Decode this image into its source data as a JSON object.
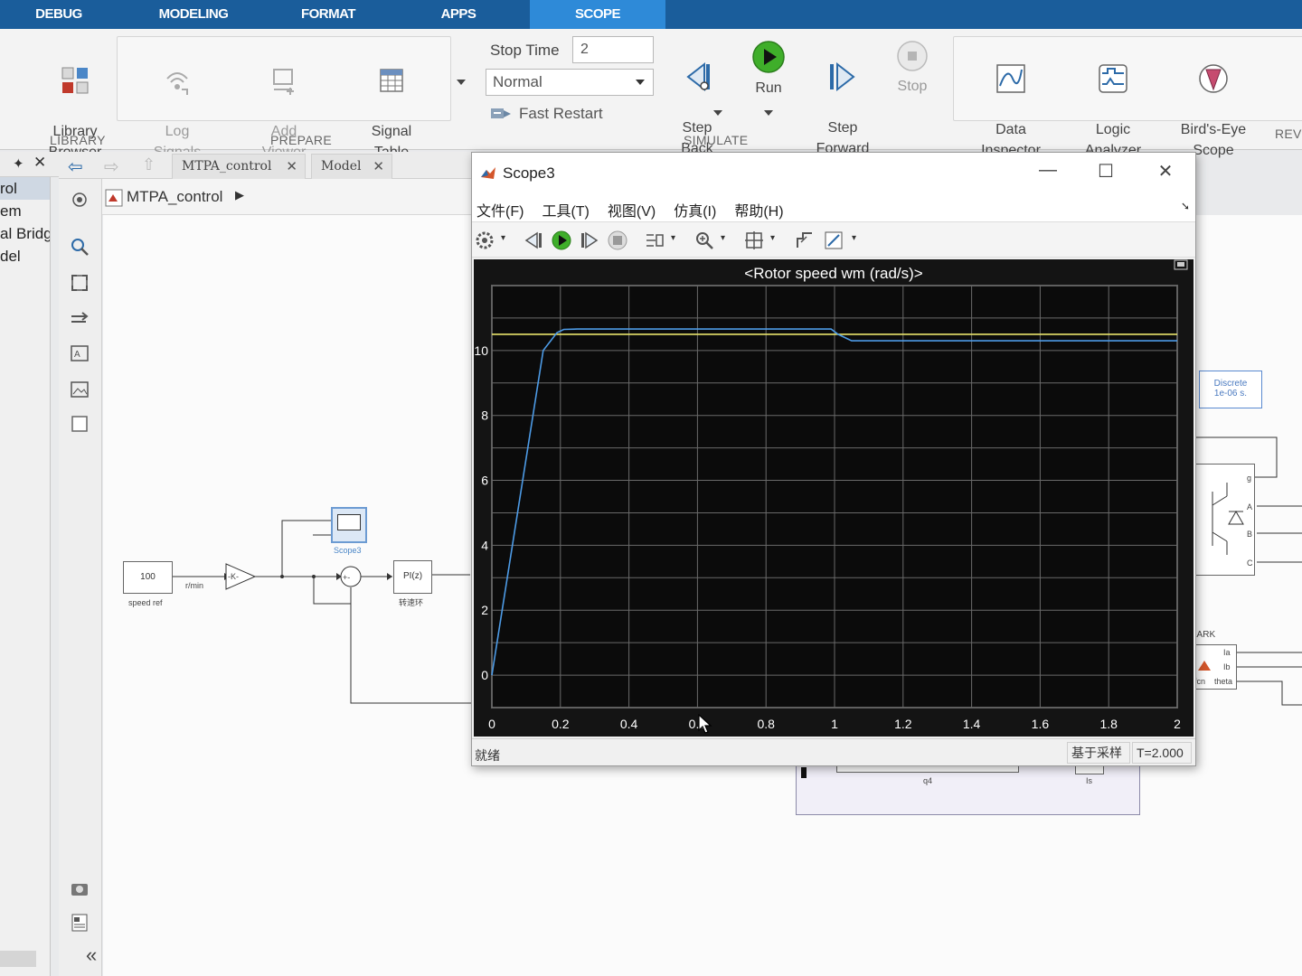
{
  "toolstrip_tabs": [
    {
      "label": "DEBUG",
      "active": false
    },
    {
      "label": "MODELING",
      "active": false
    },
    {
      "label": "FORMAT",
      "active": false
    },
    {
      "label": "APPS",
      "active": false
    },
    {
      "label": "SCOPE",
      "active": true
    }
  ],
  "ribbon": {
    "library": {
      "caption": "LIBRARY",
      "library_browser": "Library\nBrowser"
    },
    "prepare": {
      "caption": "PREPARE",
      "log_signals": "Log\nSignals",
      "add_viewer": "Add\nViewer",
      "signal_table": "Signal\nTable"
    },
    "simulate": {
      "caption": "SIMULATE",
      "stop_time_label": "Stop Time",
      "stop_time_value": "2",
      "mode_value": "Normal",
      "fast_restart": "Fast Restart",
      "step_back": "Step\nBack",
      "run": "Run",
      "step_forward": "Step\nForward",
      "stop": "Stop"
    },
    "review": {
      "caption": "REVI",
      "data_inspector": "Data\nInspector",
      "logic_analyzer": "Logic\nAnalyzer",
      "birds_eye": "Bird's-Eye\nScope"
    }
  },
  "left_panel": {
    "items": [
      "rol",
      "em",
      "al Bridg",
      "del"
    ]
  },
  "model_tabs": [
    {
      "label": "MTPA_control"
    },
    {
      "label": "Model"
    }
  ],
  "breadcrumb": {
    "model": "MTPA_control"
  },
  "diagram": {
    "const_value": "100",
    "const_label": "speed ref",
    "wire_label": "r/min",
    "gain_label": "-K-",
    "scope_label": "Scope3",
    "pi_label": "PI(z)",
    "pi_caption": "转速环",
    "discrete_line1": "Discrete",
    "discrete_line2": "1e-06 s.",
    "bridge_ports": [
      "g",
      "A",
      "B",
      "C"
    ],
    "park_label": "LARK",
    "park_ports": [
      "Ia",
      "Ib",
      "theta"
    ],
    "park_fcn": "fcn",
    "q4_label": "q4",
    "is_label": "Is"
  },
  "scope_window": {
    "title": "Scope3",
    "menu": [
      "文件(F)",
      "工具(T)",
      "视图(V)",
      "仿真(I)",
      "帮助(H)"
    ],
    "status_left": "就绪",
    "status_sample": "基于采样",
    "status_time": "T=2.000"
  },
  "chart_data": {
    "type": "line",
    "title": "<Rotor speed wm (rad/s)>",
    "xlabel": "",
    "ylabel": "",
    "xlim": [
      0,
      2
    ],
    "ylim": [
      -1,
      12
    ],
    "xticks": [
      0,
      0.2,
      0.4,
      0.6,
      0.8,
      1,
      1.2,
      1.4,
      1.6,
      1.8,
      2
    ],
    "xtick_labels": [
      "0",
      "0.2",
      "0.4",
      "0.6",
      "0.8",
      "1",
      "1.2",
      "1.4",
      "1.6",
      "1.8",
      "2"
    ],
    "yticks": [
      0,
      2,
      4,
      6,
      8,
      10
    ],
    "grid": true,
    "background": "#141414",
    "series": [
      {
        "color": "#e8e36a",
        "x": [
          0,
          2
        ],
        "y": [
          10.5,
          10.5
        ]
      },
      {
        "color": "#4d9be6",
        "x": [
          0,
          0.15,
          0.19,
          0.21,
          0.25,
          0.3,
          0.5,
          0.8,
          0.99,
          1.01,
          1.05,
          1.2,
          1.6,
          2.0
        ],
        "y": [
          0,
          10.0,
          10.55,
          10.65,
          10.66,
          10.66,
          10.66,
          10.66,
          10.66,
          10.5,
          10.3,
          10.3,
          10.3,
          10.3
        ]
      }
    ]
  },
  "colors": {
    "tab_bar": "#1a5d9b",
    "tab_active": "#2e8ad8",
    "grid": "#6a6a6a"
  }
}
